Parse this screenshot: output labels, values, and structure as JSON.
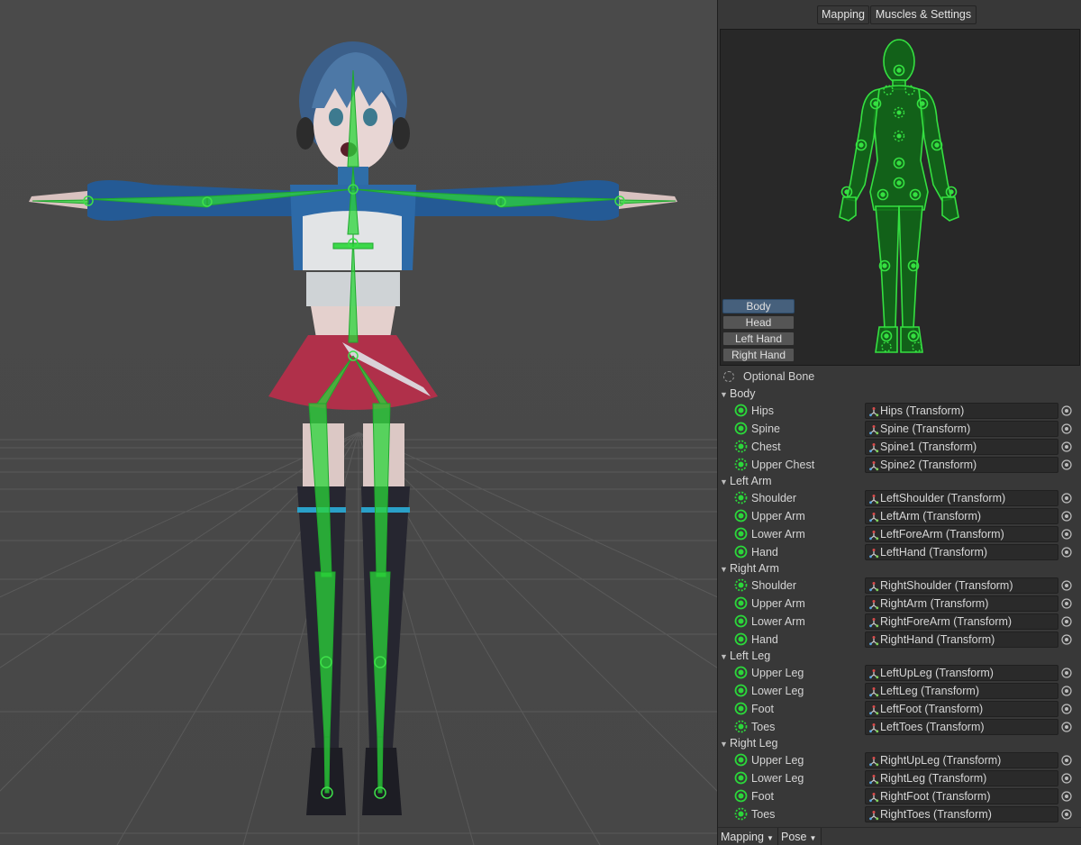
{
  "tabs": [
    {
      "label": "Mapping",
      "active": true
    },
    {
      "label": "Muscles & Settings",
      "active": false
    }
  ],
  "view_buttons": [
    {
      "label": "Body",
      "active": true
    },
    {
      "label": "Head",
      "active": false
    },
    {
      "label": "Left Hand",
      "active": false
    },
    {
      "label": "Right Hand",
      "active": false
    }
  ],
  "optional_bone_label": "Optional Bone",
  "groups": [
    {
      "name": "Body",
      "bones": [
        {
          "label": "Hips",
          "value": "Hips (Transform)",
          "optional": false
        },
        {
          "label": "Spine",
          "value": "Spine (Transform)",
          "optional": false
        },
        {
          "label": "Chest",
          "value": "Spine1 (Transform)",
          "optional": true
        },
        {
          "label": "Upper Chest",
          "value": "Spine2 (Transform)",
          "optional": true
        }
      ]
    },
    {
      "name": "Left Arm",
      "bones": [
        {
          "label": "Shoulder",
          "value": "LeftShoulder (Transform)",
          "optional": true
        },
        {
          "label": "Upper Arm",
          "value": "LeftArm (Transform)",
          "optional": false
        },
        {
          "label": "Lower Arm",
          "value": "LeftForeArm (Transform)",
          "optional": false
        },
        {
          "label": "Hand",
          "value": "LeftHand (Transform)",
          "optional": false
        }
      ]
    },
    {
      "name": "Right Arm",
      "bones": [
        {
          "label": "Shoulder",
          "value": "RightShoulder (Transform)",
          "optional": true
        },
        {
          "label": "Upper Arm",
          "value": "RightArm (Transform)",
          "optional": false
        },
        {
          "label": "Lower Arm",
          "value": "RightForeArm (Transform)",
          "optional": false
        },
        {
          "label": "Hand",
          "value": "RightHand (Transform)",
          "optional": false
        }
      ]
    },
    {
      "name": "Left Leg",
      "bones": [
        {
          "label": "Upper Leg",
          "value": "LeftUpLeg (Transform)",
          "optional": false
        },
        {
          "label": "Lower Leg",
          "value": "LeftLeg (Transform)",
          "optional": false
        },
        {
          "label": "Foot",
          "value": "LeftFoot (Transform)",
          "optional": false
        },
        {
          "label": "Toes",
          "value": "LeftToes (Transform)",
          "optional": true
        }
      ]
    },
    {
      "name": "Right Leg",
      "bones": [
        {
          "label": "Upper Leg",
          "value": "RightUpLeg (Transform)",
          "optional": false
        },
        {
          "label": "Lower Leg",
          "value": "RightLeg (Transform)",
          "optional": false
        },
        {
          "label": "Foot",
          "value": "RightFoot (Transform)",
          "optional": false
        },
        {
          "label": "Toes",
          "value": "RightToes (Transform)",
          "optional": true
        }
      ]
    }
  ],
  "bottom_bar": {
    "mapping_label": "Mapping",
    "pose_label": "Pose"
  },
  "colors": {
    "bone_green": "#2bd63a",
    "active_tab": "#46607c",
    "inspector_bg": "#383838",
    "scene_bg": "#494949"
  }
}
